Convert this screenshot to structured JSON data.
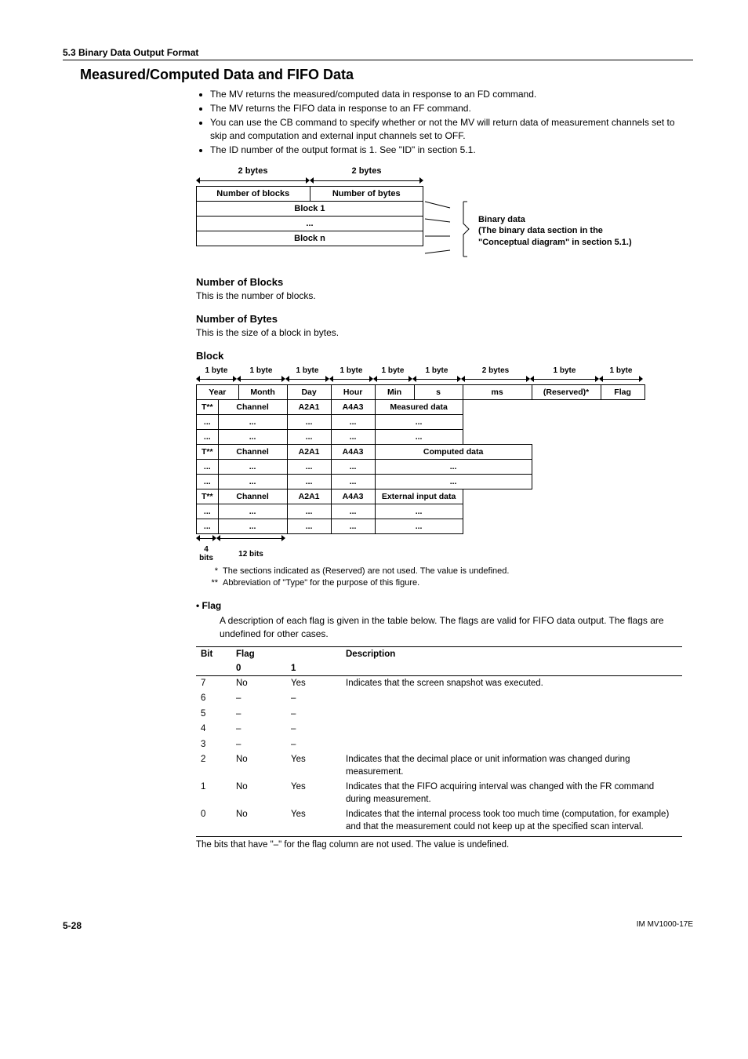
{
  "section": "5.3  Binary Data Output Format",
  "title": "Measured/Computed Data and FIFO Data",
  "bullets": [
    "The MV returns the measured/computed data in response to an FD command.",
    "The MV returns the FIFO data in response to an FF command.",
    "You can use the CB command to specify whether or not the MV will return data of measurement channels set to skip and computation and external input channels set to OFF.",
    "The ID number of the output format is 1. See \"ID\" in section 5.1."
  ],
  "diag1": {
    "dim_left": "2 bytes",
    "dim_right": "2 bytes",
    "header_left": "Number of blocks",
    "header_right": "Number of bytes",
    "rows": [
      "Block 1",
      "...",
      "Block n"
    ],
    "brace_top": "Binary data",
    "brace_mid": "(The binary data section in the",
    "brace_bot": "\"Conceptual diagram\" in section 5.1.)"
  },
  "num_blocks_h": "Number of Blocks",
  "num_blocks_t": "This is the number of blocks.",
  "num_bytes_h": "Number of Bytes",
  "num_bytes_t": "This is the size of a block in bytes.",
  "block_h": "Block",
  "block_dims": [
    "1 byte",
    "1 byte",
    "1 byte",
    "1 byte",
    "1 byte",
    "1 byte",
    "2 bytes",
    "1 byte",
    "1 byte"
  ],
  "block_row1": [
    "Year",
    "Month",
    "Day",
    "Hour",
    "Min",
    "s",
    "ms",
    "(Reserved)*",
    "Flag"
  ],
  "block_rows": [
    [
      "T**",
      "Channel",
      "A2A1",
      "A4A3",
      "Measured data"
    ],
    [
      "...",
      "...",
      "...",
      "...",
      "..."
    ],
    [
      "...",
      "...",
      "...",
      "...",
      "..."
    ],
    [
      "T**",
      "Channel",
      "A2A1",
      "A4A3",
      "Computed data"
    ],
    [
      "...",
      "...",
      "...",
      "...",
      "..."
    ],
    [
      "...",
      "...",
      "...",
      "...",
      "..."
    ],
    [
      "T**",
      "Channel",
      "A2A1",
      "A4A3",
      "External input data"
    ],
    [
      "...",
      "...",
      "...",
      "...",
      "..."
    ],
    [
      "...",
      "...",
      "...",
      "...",
      "..."
    ]
  ],
  "bits_small": "4 bits",
  "bits_large": "12 bits",
  "note1": "The sections indicated as (Reserved) are not used. The value is undefined.",
  "note2": "Abbreviation of \"Type\" for the purpose of this figure.",
  "flag_bullet": "•  Flag",
  "flag_intro": "A description of each flag is given in the table below. The flags are valid for FIFO data output. The flags are undefined for other cases.",
  "flag_headers": {
    "bit": "Bit",
    "flag": "Flag",
    "desc": "Description",
    "z": "0",
    "o": "1"
  },
  "flag_rows": [
    {
      "bit": "7",
      "f0": "No",
      "f1": "Yes",
      "desc": "Indicates that the screen snapshot was executed."
    },
    {
      "bit": "6",
      "f0": "–",
      "f1": "–",
      "desc": ""
    },
    {
      "bit": "5",
      "f0": "–",
      "f1": "–",
      "desc": ""
    },
    {
      "bit": "4",
      "f0": "–",
      "f1": "–",
      "desc": ""
    },
    {
      "bit": "3",
      "f0": "–",
      "f1": "–",
      "desc": ""
    },
    {
      "bit": "2",
      "f0": "No",
      "f1": "Yes",
      "desc": "Indicates that the decimal place or unit information was changed during measurement."
    },
    {
      "bit": "1",
      "f0": "No",
      "f1": "Yes",
      "desc": "Indicates that the FIFO acquiring interval was changed with the FR command during measurement."
    },
    {
      "bit": "0",
      "f0": "No",
      "f1": "Yes",
      "desc": "Indicates that the internal process took too much time (computation, for example) and that the measurement could not keep up at the specified scan interval."
    }
  ],
  "flag_footnote": "The bits that have \"–\" for the flag column are not used. The value is undefined.",
  "footer_page": "5-28",
  "footer_doc": "IM MV1000-17E"
}
